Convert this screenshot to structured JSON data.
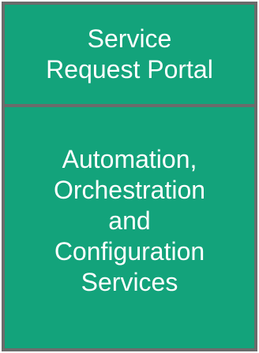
{
  "colors": {
    "box_fill": "#13a37b",
    "border": "#6b6b6b",
    "text": "#ffffff"
  },
  "top_box": {
    "lines": [
      "Service",
      "Request Portal"
    ]
  },
  "bottom_box": {
    "lines": [
      "Automation,",
      "Orchestration",
      "and",
      "Configuration",
      "Services"
    ]
  }
}
